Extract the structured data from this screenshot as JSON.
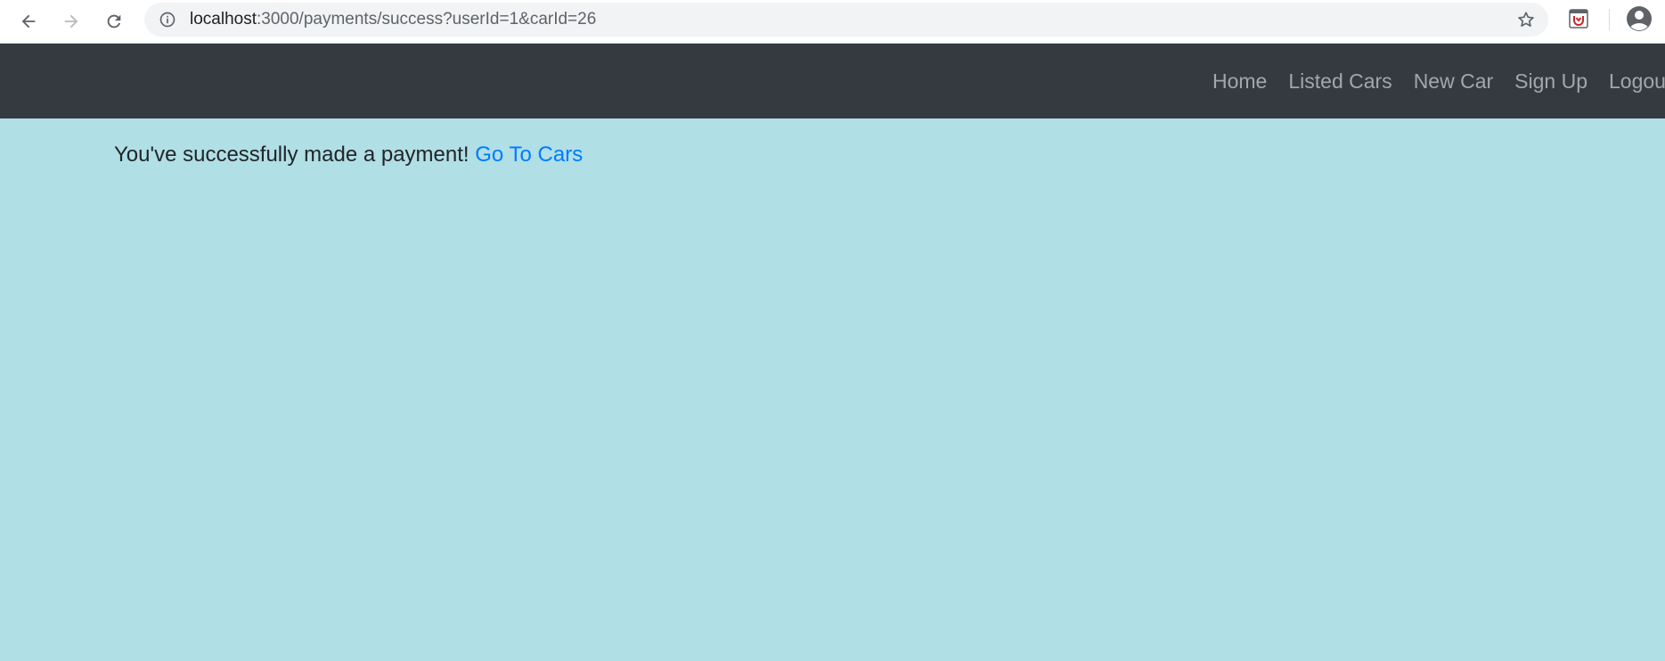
{
  "browser": {
    "url_host": "localhost",
    "url_rest": ":3000/payments/success?userId=1&carId=26",
    "icons": {
      "back": "back-arrow-icon",
      "forward": "forward-arrow-icon",
      "reload": "reload-icon",
      "info": "info-icon",
      "bookmark": "star-icon",
      "extension": "extension-icon",
      "profile": "profile-icon"
    }
  },
  "navbar": {
    "background": "#343a40",
    "links": [
      {
        "label": "Home"
      },
      {
        "label": "Listed Cars"
      },
      {
        "label": "New Car"
      },
      {
        "label": "Sign Up"
      },
      {
        "label": "Logout"
      }
    ]
  },
  "main": {
    "background": "#b0dfe5",
    "message": "You've successfully made a payment!",
    "link_label": "Go To Cars",
    "link_color": "#007bff"
  }
}
